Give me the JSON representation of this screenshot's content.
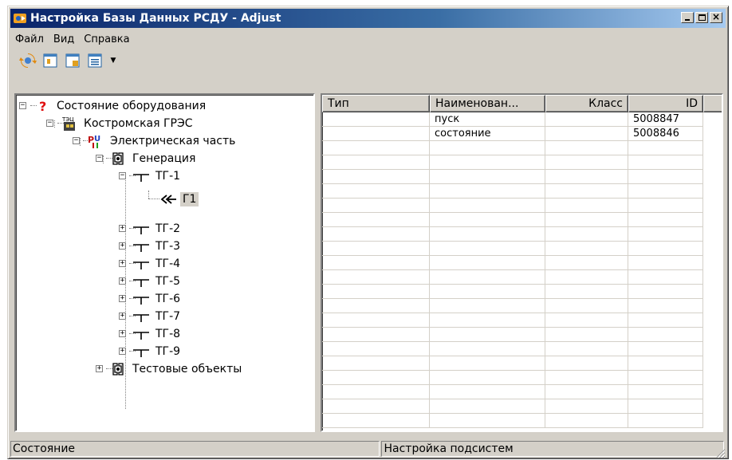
{
  "window": {
    "title": "Настройка Базы Данных РСДУ - Adjust",
    "icon": "app-icon",
    "buttons": [
      "minimize",
      "maximize",
      "close"
    ]
  },
  "menu": [
    "Файл",
    "Вид",
    "Справка"
  ],
  "toolbar": {
    "tools": [
      "refresh-icon",
      "properties-icon",
      "new-item-icon",
      "list-view-icon"
    ],
    "dropdown": "chevron-down-icon"
  },
  "tree": {
    "nodes": [
      {
        "label": "Состояние оборудования",
        "icon": "question-icon",
        "expanded": true
      },
      {
        "label": "Костромская ГРЭС",
        "icon": "power-plant-icon",
        "badge": "ТЭЦ",
        "expanded": true
      },
      {
        "label": "Электрическая часть",
        "icon": "electrical-icon",
        "expanded": true
      },
      {
        "label": "Генерация",
        "icon": "gear-folder-icon",
        "expanded": true
      },
      {
        "label": "ТГ-1",
        "icon": "turbine-icon",
        "expanded": true
      },
      {
        "label": "Г1",
        "icon": "generator-icon",
        "selected": true
      },
      {
        "label": "ТГ-2",
        "icon": "turbine-icon",
        "expanded": false
      },
      {
        "label": "ТГ-3",
        "icon": "turbine-icon",
        "expanded": false
      },
      {
        "label": "ТГ-4",
        "icon": "turbine-icon",
        "expanded": false
      },
      {
        "label": "ТГ-5",
        "icon": "turbine-icon",
        "expanded": false
      },
      {
        "label": "ТГ-6",
        "icon": "turbine-icon",
        "expanded": false
      },
      {
        "label": "ТГ-7",
        "icon": "turbine-icon",
        "expanded": false
      },
      {
        "label": "ТГ-8",
        "icon": "turbine-icon",
        "expanded": false
      },
      {
        "label": "ТГ-9",
        "icon": "turbine-icon",
        "expanded": false
      },
      {
        "label": "Тестовые объекты",
        "icon": "gear-folder-icon",
        "expanded": false
      }
    ]
  },
  "list": {
    "columns": [
      "Тип",
      "Наименован...",
      "Класс",
      "ID"
    ],
    "rows": [
      [
        "",
        "пуск",
        "",
        "5008847"
      ],
      [
        "",
        "состояние",
        "",
        "5008846"
      ]
    ]
  },
  "status": {
    "left": "Состояние",
    "right": "Настройка подсистем"
  },
  "colors": {
    "title_start": "#0a246a",
    "title_end": "#a6caf0",
    "face": "#d4d0c8"
  }
}
